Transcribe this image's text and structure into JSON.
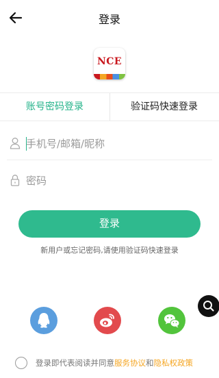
{
  "header": {
    "title": "登录"
  },
  "logo": {
    "text": "NCE"
  },
  "tabs": [
    {
      "label": "账号密码登录",
      "active": true
    },
    {
      "label": "验证码快速登录",
      "active": false
    }
  ],
  "fields": {
    "account_placeholder": "手机号/邮箱/昵称",
    "password_placeholder": "密码"
  },
  "login_button": "登录",
  "hint": "新用户或忘记密码,请使用验证码快速登录",
  "social": [
    "qq-icon",
    "weibo-icon",
    "wechat-icon"
  ],
  "agreement": {
    "prefix": "登录即代表阅读并同意",
    "service_link": "服务协议",
    "and": "和",
    "privacy_link": "隐私权政策"
  },
  "colors": {
    "accent": "#2fba8e",
    "link": "#f5a623",
    "qq": "#5b9ede",
    "weibo": "#e24a4d",
    "wechat": "#52c43c"
  }
}
